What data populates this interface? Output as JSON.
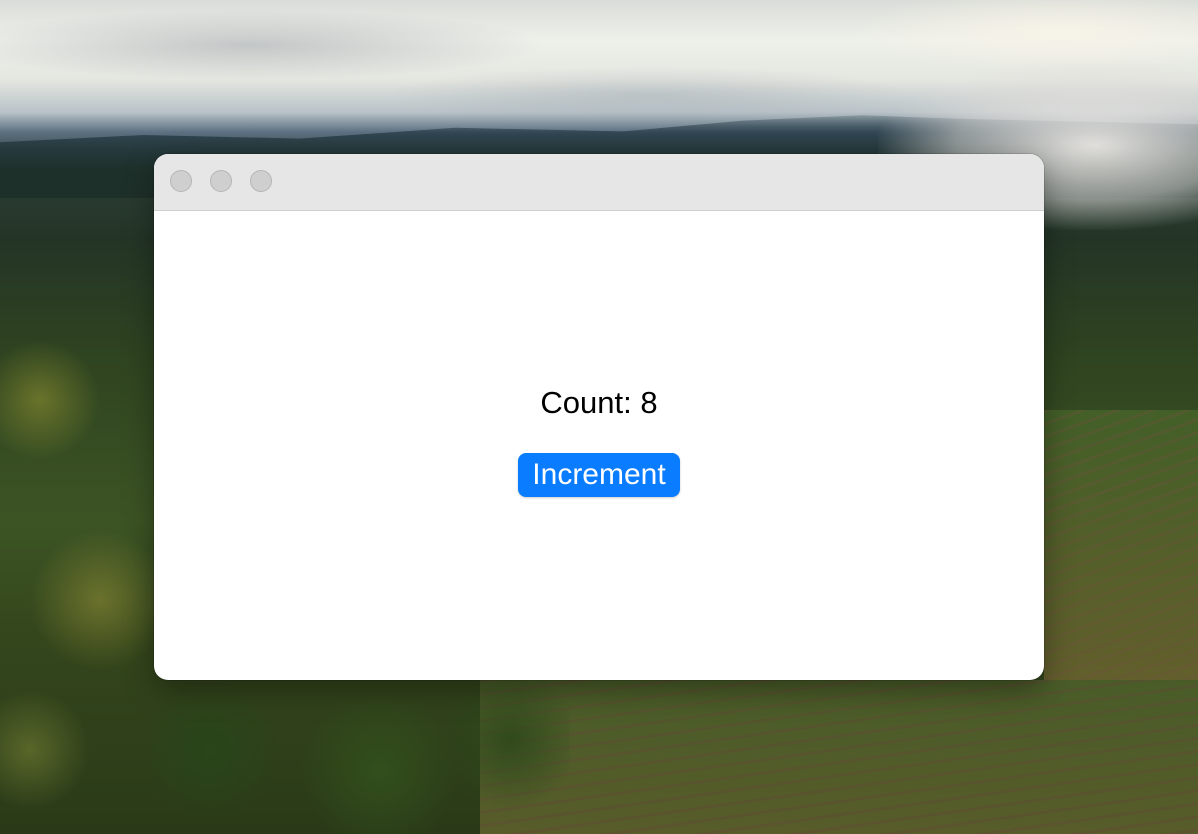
{
  "window": {
    "traffic_lights": [
      "close",
      "minimize",
      "maximize"
    ]
  },
  "counter": {
    "count_label": "Count: 8",
    "count_value": 8,
    "increment_label": "Increment"
  },
  "colors": {
    "button_accent": "#0a7cff",
    "titlebar": "#e6e6e6",
    "traffic_light_inactive": "#cfcfcf"
  }
}
